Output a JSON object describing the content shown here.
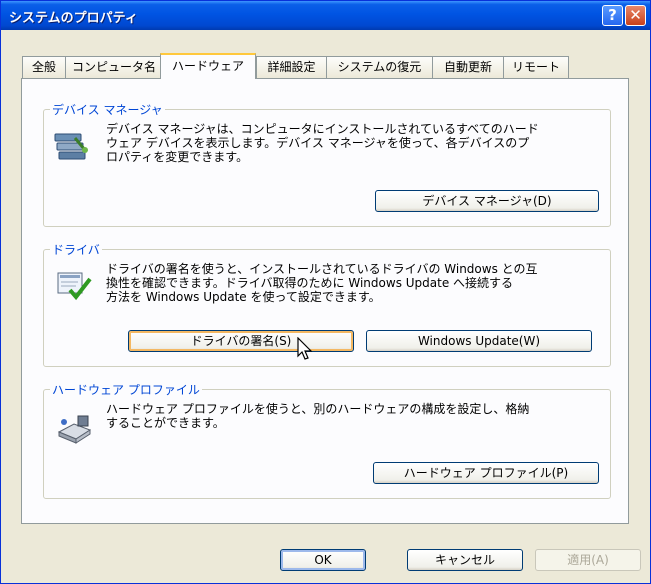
{
  "window": {
    "title": "システムのプロパティ"
  },
  "titlebar": {
    "help_glyph": "?",
    "close_glyph": "✕"
  },
  "tabs": [
    {
      "label": "全般"
    },
    {
      "label": "コンピュータ名"
    },
    {
      "label": "ハードウェア",
      "selected": true
    },
    {
      "label": "詳細設定"
    },
    {
      "label": "システムの復元"
    },
    {
      "label": "自動更新"
    },
    {
      "label": "リモート"
    }
  ],
  "device_manager": {
    "title": "デバイス マネージャ",
    "description": "デバイス マネージャは、コンピュータにインストールされているすべてのハード\nウェア デバイスを表示します。デバイス マネージャを使って、各デバイスのプ\nロパティを変更できます。",
    "button_label": "デバイス マネージャ(D)",
    "icon": "device-manager-icon"
  },
  "drivers": {
    "title": "ドライバ",
    "description": "ドライバの署名を使うと、インストールされているドライバの Windows との互\n換性を確認できます。ドライバ取得のために Windows Update へ接続する\n方法を Windows Update を使って設定できます。",
    "signing_button_label": "ドライバの署名(S)",
    "update_button_label": "Windows Update(W)",
    "icon": "driver-check-icon"
  },
  "hardware_profiles": {
    "title": "ハードウェア プロファイル",
    "description": "ハードウェア プロファイルを使うと、別のハードウェアの構成を設定し、格納\nすることができます。",
    "button_label": "ハードウェア プロファイル(P)",
    "icon": "hardware-profile-icon"
  },
  "footer": {
    "ok_label": "OK",
    "cancel_label": "キャンセル",
    "apply_label": "適用(A)"
  },
  "colors": {
    "titlebar": "#0054e3",
    "group_title": "#0046d5",
    "active_tab_highlight": "#ffc83c"
  }
}
